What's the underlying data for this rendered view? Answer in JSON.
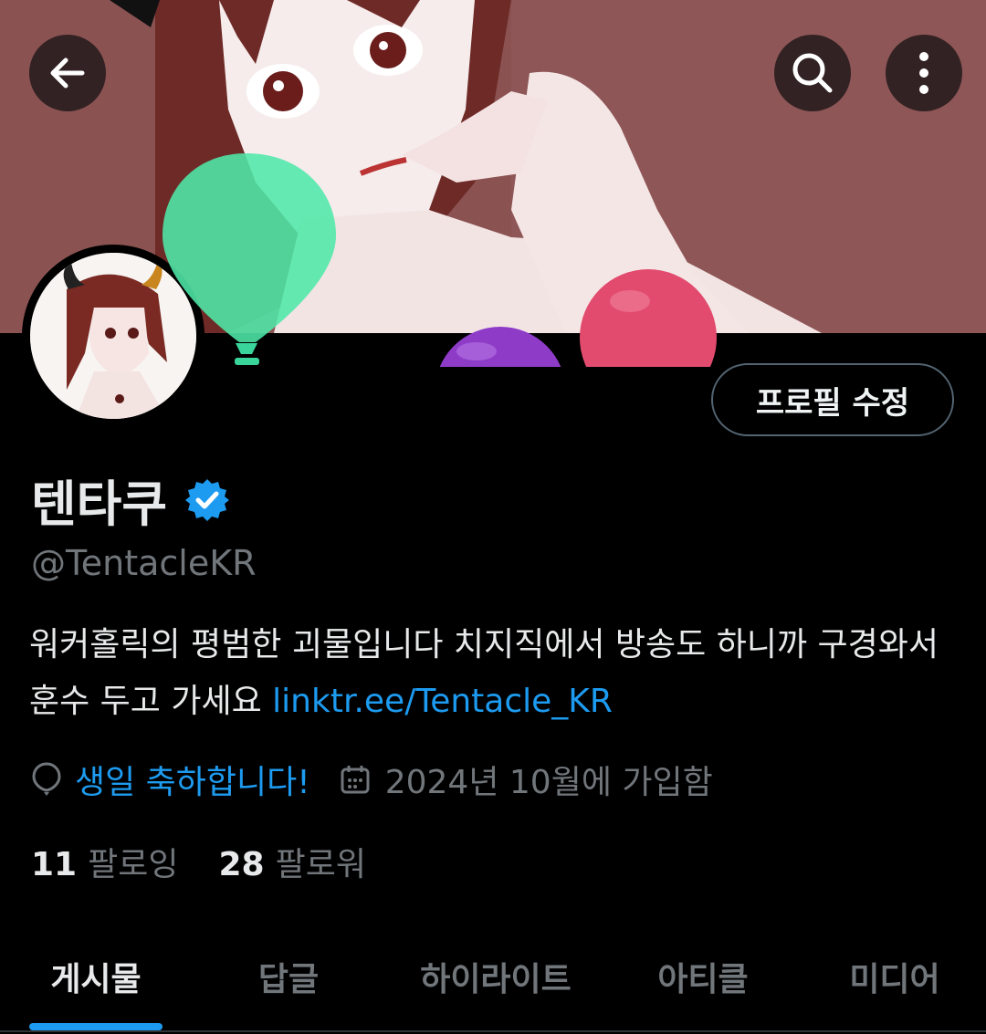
{
  "header": {
    "back_icon": "arrow-left-icon",
    "search_icon": "search-icon",
    "more_icon": "more-vertical-icon"
  },
  "profile": {
    "edit_button_label": "프로필 수정",
    "display_name": "텐타쿠",
    "verified_icon": "verified-badge-icon",
    "handle": "@TentacleKR",
    "bio_text": "워커홀릭의 평범한 괴물입니다 치지직에서 방송도 하니까 구경와서 훈수 두고 가세요 ",
    "bio_link": "linktr.ee/Tentacle_KR",
    "birthday_icon": "balloon-icon",
    "birthday_text": "생일 축하합니다!",
    "calendar_icon": "calendar-icon",
    "joined_text": "2024년 10월에 가입함",
    "following_count": "11",
    "following_label": "팔로잉",
    "followers_count": "28",
    "followers_label": "팔로워"
  },
  "tabs": [
    {
      "label": "게시물",
      "active": true
    },
    {
      "label": "답글",
      "active": false
    },
    {
      "label": "하이라이트",
      "active": false
    },
    {
      "label": "아티클",
      "active": false
    },
    {
      "label": "미디어",
      "active": false
    }
  ],
  "colors": {
    "accent": "#1d9bf0",
    "background": "#000000",
    "text_primary": "#e7e9ea",
    "text_secondary": "#71767b"
  }
}
